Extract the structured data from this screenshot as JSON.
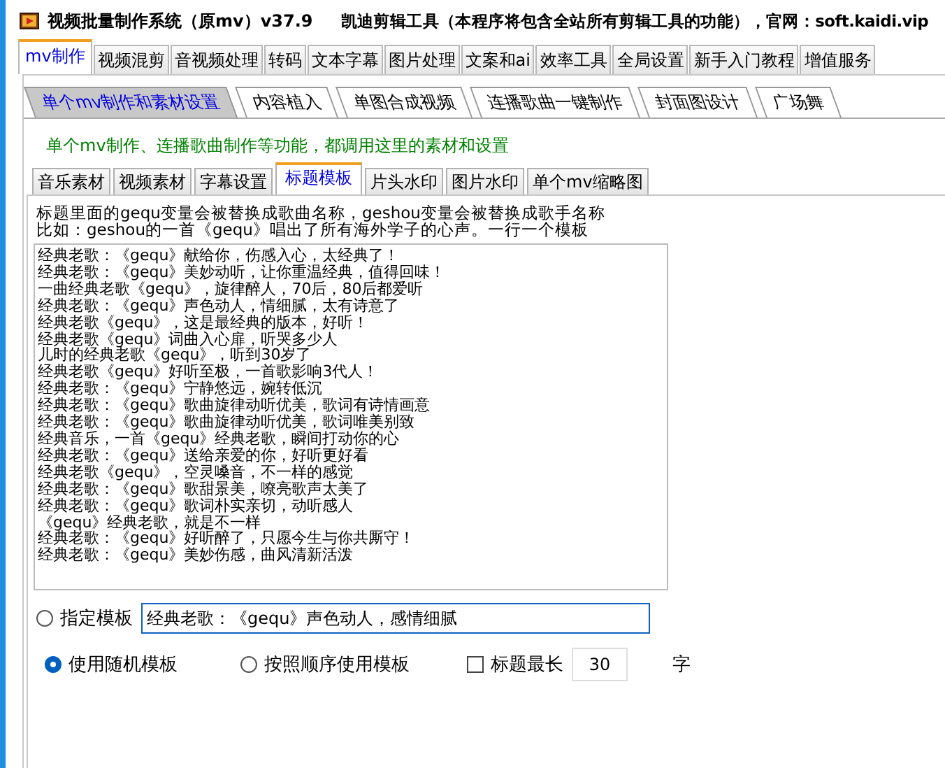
{
  "window": {
    "title": "视频批量制作系统（原mv）v37.9",
    "subtitle": "凯迪剪辑工具（本程序将包含全站所有剪辑工具的功能），官网：soft.kaidi.vip"
  },
  "main_tabs": [
    {
      "label": "mv制作",
      "selected": true
    },
    {
      "label": "视频混剪",
      "selected": false
    },
    {
      "label": "音视频处理",
      "selected": false
    },
    {
      "label": "转码",
      "selected": false
    },
    {
      "label": "文本字幕",
      "selected": false
    },
    {
      "label": "图片处理",
      "selected": false
    },
    {
      "label": "文案和ai",
      "selected": false
    },
    {
      "label": "效率工具",
      "selected": false
    },
    {
      "label": "全局设置",
      "selected": false
    },
    {
      "label": "新手入门教程",
      "selected": false
    },
    {
      "label": "增值服务",
      "selected": false
    }
  ],
  "sub_tabs": [
    {
      "label": "单个mv制作和素材设置",
      "selected": true
    },
    {
      "label": "内容植入",
      "selected": false
    },
    {
      "label": "单图合成视频",
      "selected": false
    },
    {
      "label": "连播歌曲一键制作",
      "selected": false
    },
    {
      "label": "封面图设计",
      "selected": false
    },
    {
      "label": "广场舞",
      "selected": false
    }
  ],
  "notice": "单个mv制作、连播歌曲制作等功能，都调用这里的素材和设置",
  "settings_tabs": [
    {
      "label": "音乐素材",
      "selected": false
    },
    {
      "label": "视频素材",
      "selected": false
    },
    {
      "label": "字幕设置",
      "selected": false
    },
    {
      "label": "标题模板",
      "selected": true
    },
    {
      "label": "片头水印",
      "selected": false
    },
    {
      "label": "图片水印",
      "selected": false
    },
    {
      "label": "单个mv缩略图",
      "selected": false
    }
  ],
  "description": [
    "标题里面的gequ变量会被替换成歌曲名称，geshou变量会被替换成歌手名称",
    "比如：geshou的一首《gequ》唱出了所有海外学子的心声。一行一个模板"
  ],
  "templates": [
    "经典老歌：《gequ》献给你，伤感入心，太经典了！",
    "经典老歌：《gequ》美妙动听，让你重温经典，值得回味！",
    "一曲经典老歌《gequ》，旋律醉人，70后，80后都爱听",
    "经典老歌：《gequ》声色动人，情细腻，太有诗意了",
    "经典老歌《gequ》，这是最经典的版本，好听！",
    "经典老歌《gequ》词曲入心扉，听哭多少人",
    "儿时的经典老歌《gequ》，听到30岁了",
    "经典老歌《gequ》好听至极，一首歌影响3代人！",
    "经典老歌：《gequ》宁静悠远，婉转低沉",
    "经典老歌：《gequ》歌曲旋律动听优美，歌词有诗情画意",
    "经典老歌：《gequ》歌曲旋律动听优美，歌词唯美别致",
    "经典音乐，一首《gequ》经典老歌，瞬间打动你的心",
    "经典老歌：《gequ》送给亲爱的你，好听更好看",
    "经典老歌《gequ》，空灵嗓音，不一样的感觉",
    "经典老歌：《gequ》歌甜景美，嘹亮歌声太美了",
    "经典老歌：《gequ》歌词朴实亲切，动听感人",
    "《gequ》经典老歌，就是不一样",
    "经典老歌：《gequ》好听醉了，只愿今生与你共厮守！",
    "经典老歌：《gequ》美妙伤感，曲风清新活泼"
  ],
  "fixed_template": {
    "label": "指定模板",
    "selected": false,
    "value": "经典老歌：《gequ》声色动人，感情细腻"
  },
  "order_options": [
    {
      "label": "使用随机模板",
      "selected": true
    },
    {
      "label": "按照顺序使用模板",
      "selected": false
    }
  ],
  "max_length": {
    "label": "标题最长",
    "checked": false,
    "value": "30",
    "unit": "字"
  }
}
